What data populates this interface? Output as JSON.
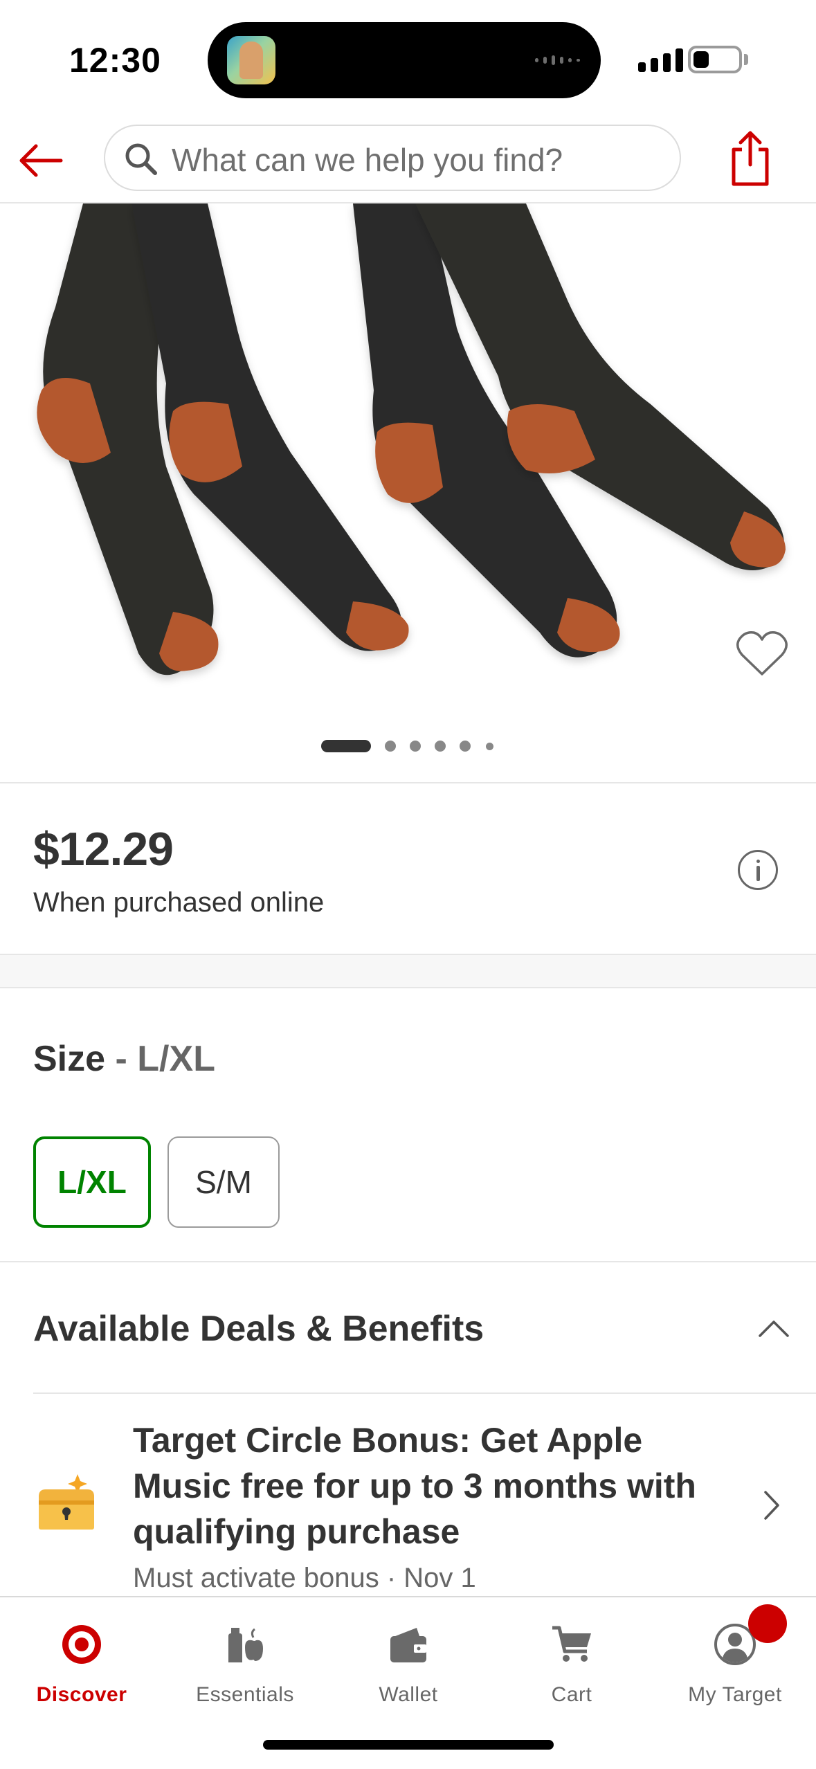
{
  "status_bar": {
    "time": "12:30"
  },
  "header": {
    "search_placeholder": "What can we help you find?",
    "icons": [
      "back-arrow-icon",
      "search-icon",
      "share-icon"
    ]
  },
  "product": {
    "image_carousel": {
      "total_images": 6,
      "current_index": 1
    },
    "favorite_icon": "heart-outline-icon"
  },
  "pricing": {
    "price": "$12.29",
    "note": "When purchased online",
    "info_icon": "info-icon"
  },
  "size": {
    "label": "Size",
    "separator": "-",
    "selected_value": "L/XL",
    "options": [
      {
        "label": "L/XL",
        "selected": true
      },
      {
        "label": "S/M",
        "selected": false
      }
    ]
  },
  "deals": {
    "heading": "Available Deals & Benefits",
    "expanded": true,
    "items": [
      {
        "title": "Target Circle Bonus: Get Apple Music free for up to 3 months with qualifying purchase",
        "subtitle": "Must activate bonus · Nov 1",
        "icon": "treasure-chest-icon"
      }
    ]
  },
  "tab_bar": {
    "active": "Discover",
    "tabs": [
      {
        "label": "Discover",
        "icon": "bullseye-icon"
      },
      {
        "label": "Essentials",
        "icon": "essentials-icon"
      },
      {
        "label": "Wallet",
        "icon": "wallet-icon"
      },
      {
        "label": "Cart",
        "icon": "cart-icon"
      },
      {
        "label": "My Target",
        "icon": "profile-icon"
      }
    ]
  },
  "colors": {
    "brand_red": "#cc0000",
    "selected_green": "#008300",
    "text_dark": "#333333",
    "text_muted": "#666666",
    "sock_black": "#2b2c29",
    "sock_copper": "#b4582f"
  }
}
